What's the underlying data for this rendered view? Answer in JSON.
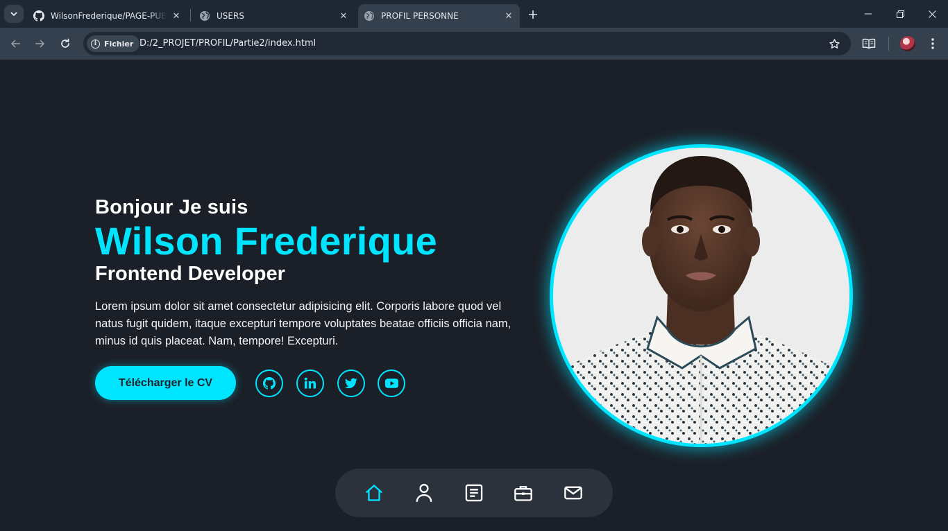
{
  "browser": {
    "tabs": [
      {
        "title": "WilsonFrederique/PAGE-PUBLIC",
        "icon": "github-icon",
        "active": false
      },
      {
        "title": "USERS",
        "icon": "globe-icon",
        "active": false
      },
      {
        "title": "PROFIL PERSONNE",
        "icon": "globe-icon",
        "active": true
      }
    ],
    "address": {
      "chip_label": "Fichier",
      "url": "D:/2_PROJET/PROFIL/Partie2/index.html"
    }
  },
  "hero": {
    "greeting": "Bonjour Je suis",
    "name": "Wilson Frederique",
    "role": "Frontend Developer",
    "description": "Lorem ipsum dolor sit amet consectetur adipisicing elit. Corporis labore quod vel natus fugit quidem, itaque excepturi tempore voluptates beatae officiis officia nam, minus id quis placeat. Nam, tempore! Excepturi.",
    "cv_button": "Télécharger le CV",
    "socials": [
      "github-icon",
      "linkedin-icon",
      "twitter-icon",
      "youtube-icon"
    ]
  },
  "dock": {
    "items": [
      "home-icon",
      "user-icon",
      "article-icon",
      "briefcase-icon",
      "mail-icon"
    ],
    "active": "home-icon"
  },
  "colors": {
    "accent": "#00e5ff",
    "background": "#1b1f27",
    "dock": "#2b323c",
    "chrome_tabbar": "#1e2734",
    "chrome_toolbar": "#34404e"
  }
}
